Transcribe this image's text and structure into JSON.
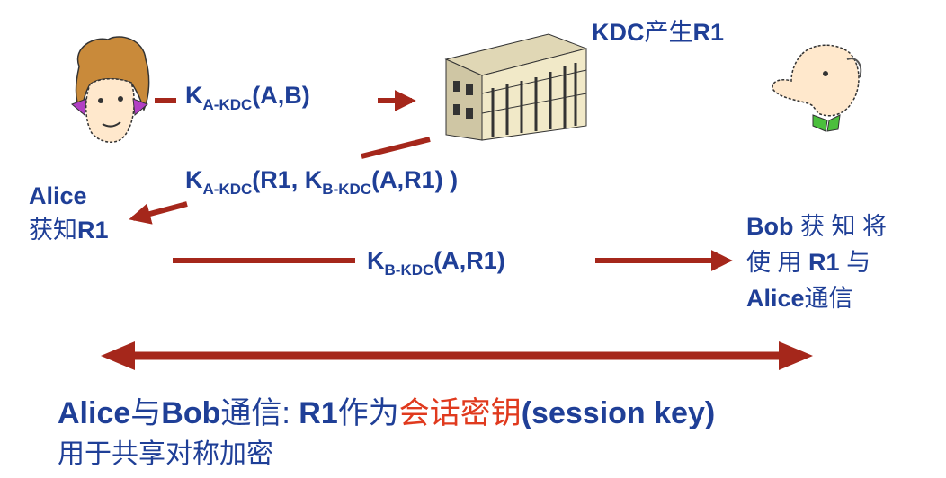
{
  "kdc_label": {
    "prefix": "KDC",
    "cn": "产生",
    "suffix": "R1"
  },
  "msg1": {
    "k": "K",
    "sub": "A-KDC",
    "rest": "(A,B)"
  },
  "msg2": {
    "k": "K",
    "sub": "A-KDC",
    "mid": "(R1, K",
    "sub2": "B-KDC",
    "rest": "(A,R1) )"
  },
  "msg3": {
    "k": "K",
    "sub": "B-KDC",
    "rest": "(A,R1)"
  },
  "alice": {
    "name": "Alice",
    "learn_cn": "获知",
    "learn_r1": "R1"
  },
  "bob": {
    "line1_bob": "Bob",
    "line1_cn": "获 知 将",
    "line2_cn1": "使 用",
    "line2_r1": "R1",
    "line2_cn2": "与",
    "line3_alice": "Alice",
    "line3_cn": "通信"
  },
  "bottom": {
    "line1_a": "Alice",
    "line1_b": "与",
    "line1_c": "Bob",
    "line1_d": "通信:",
    "line1_e": "R1",
    "line1_f": "作为",
    "line1_red": "会话密钥",
    "line1_g": "(session key)",
    "line2": "用于共享对称加密"
  },
  "colors": {
    "arrow": "#a5271b",
    "text": "#1f3f97",
    "highlight": "#e03a1e"
  }
}
